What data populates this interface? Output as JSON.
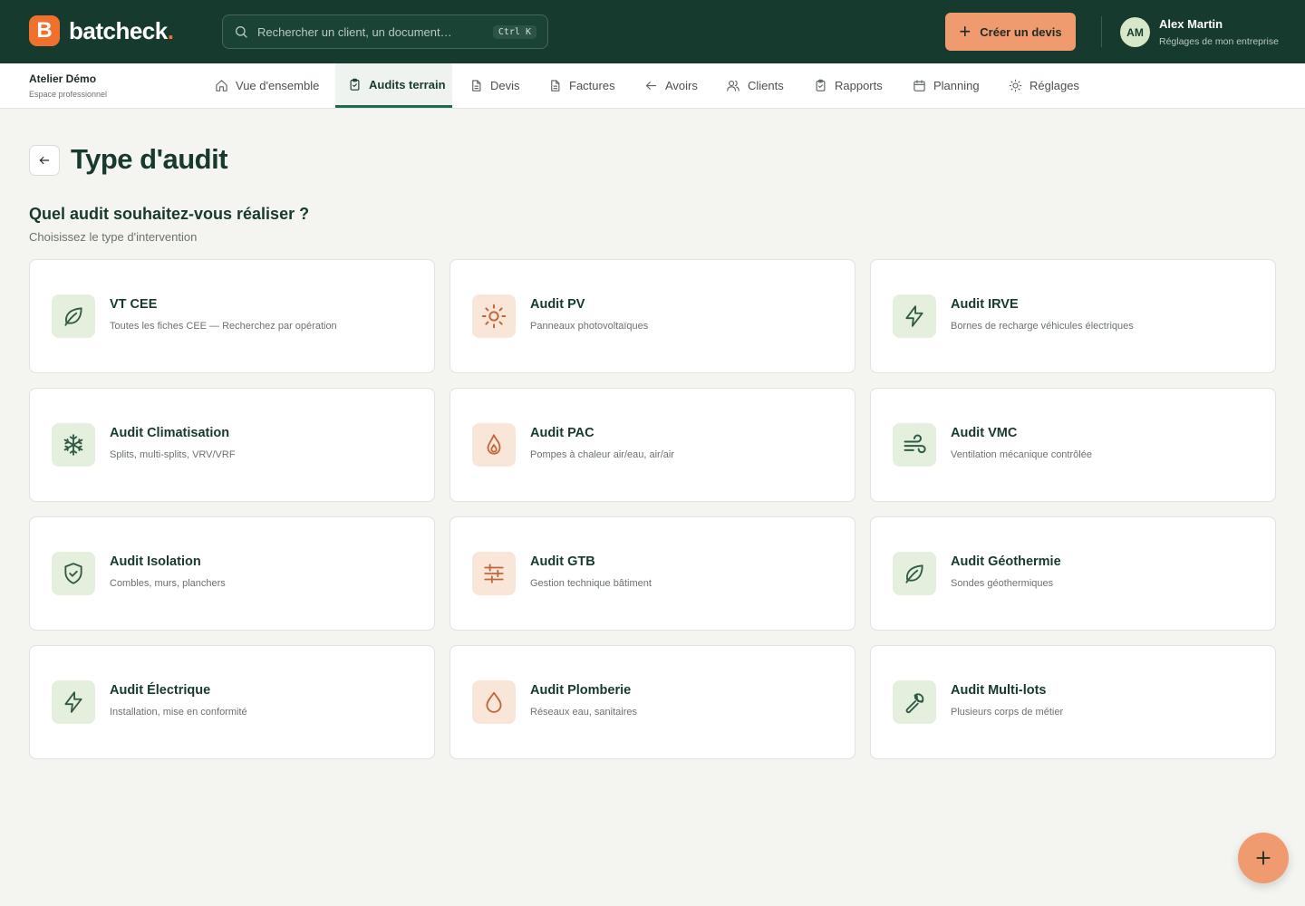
{
  "brand": {
    "logo_letter": "B",
    "name": "batcheck",
    "dot": "."
  },
  "search": {
    "placeholder": "Rechercher un client, un document…",
    "shortcut": "Ctrl K"
  },
  "header": {
    "cta_label": "Créer un devis"
  },
  "user": {
    "initials": "AM",
    "name": "Alex Martin",
    "subtitle": "Réglages de mon entreprise"
  },
  "workspace": {
    "name": "Atelier Démo",
    "subtitle": "Espace professionnel"
  },
  "nav": {
    "items": [
      {
        "label": "Vue d'ensemble",
        "icon": "home-icon"
      },
      {
        "label": "Audits terrain",
        "icon": "clipboard-check-icon",
        "active": true
      },
      {
        "label": "Devis",
        "icon": "document-icon"
      },
      {
        "label": "Factures",
        "icon": "document-icon"
      },
      {
        "label": "Avoirs",
        "icon": "arrow-left-icon"
      },
      {
        "label": "Clients",
        "icon": "users-icon"
      },
      {
        "label": "Rapports",
        "icon": "clipboard-icon"
      },
      {
        "label": "Planning",
        "icon": "calendar-icon"
      },
      {
        "label": "Réglages",
        "icon": "sun-gear-icon"
      }
    ]
  },
  "page": {
    "title": "Type d'audit",
    "section_title": "Quel audit souhaitez-vous réaliser ?",
    "section_subtitle": "Choisissez le type d'intervention"
  },
  "audits": [
    {
      "title": "VT CEE",
      "desc": "Toutes les fiches CEE — Recherchez par opération",
      "icon": "leaf-icon",
      "tone": "green"
    },
    {
      "title": "Audit PV",
      "desc": "Panneaux photovoltaïques",
      "icon": "sun-icon",
      "tone": "orange"
    },
    {
      "title": "Audit IRVE",
      "desc": "Bornes de recharge véhicules électriques",
      "icon": "lightning-icon",
      "tone": "green"
    },
    {
      "title": "Audit Climatisation",
      "desc": "Splits, multi-splits, VRV/VRF",
      "icon": "snowflake-icon",
      "tone": "green"
    },
    {
      "title": "Audit PAC",
      "desc": "Pompes à chaleur air/eau, air/air",
      "icon": "flame-icon",
      "tone": "orange"
    },
    {
      "title": "Audit VMC",
      "desc": "Ventilation mécanique contrôlée",
      "icon": "wind-icon",
      "tone": "green"
    },
    {
      "title": "Audit Isolation",
      "desc": "Combles, murs, planchers",
      "icon": "shield-check-icon",
      "tone": "green"
    },
    {
      "title": "Audit GTB",
      "desc": "Gestion technique bâtiment",
      "icon": "sliders-icon",
      "tone": "orange"
    },
    {
      "title": "Audit Géothermie",
      "desc": "Sondes géothermiques",
      "icon": "leaf-icon",
      "tone": "green"
    },
    {
      "title": "Audit Électrique",
      "desc": "Installation, mise en conformité",
      "icon": "lightning-icon",
      "tone": "green"
    },
    {
      "title": "Audit Plomberie",
      "desc": "Réseaux eau, sanitaires",
      "icon": "droplet-icon",
      "tone": "orange"
    },
    {
      "title": "Audit Multi-lots",
      "desc": "Plusieurs corps de métier",
      "icon": "wrench-icon",
      "tone": "green"
    }
  ],
  "colors": {
    "primary_dark": "#163a2d",
    "accent": "#ef9a6f",
    "brand_orange": "#f0702d",
    "icon_green": "#2f5a45",
    "icon_orange": "#c0683a"
  }
}
